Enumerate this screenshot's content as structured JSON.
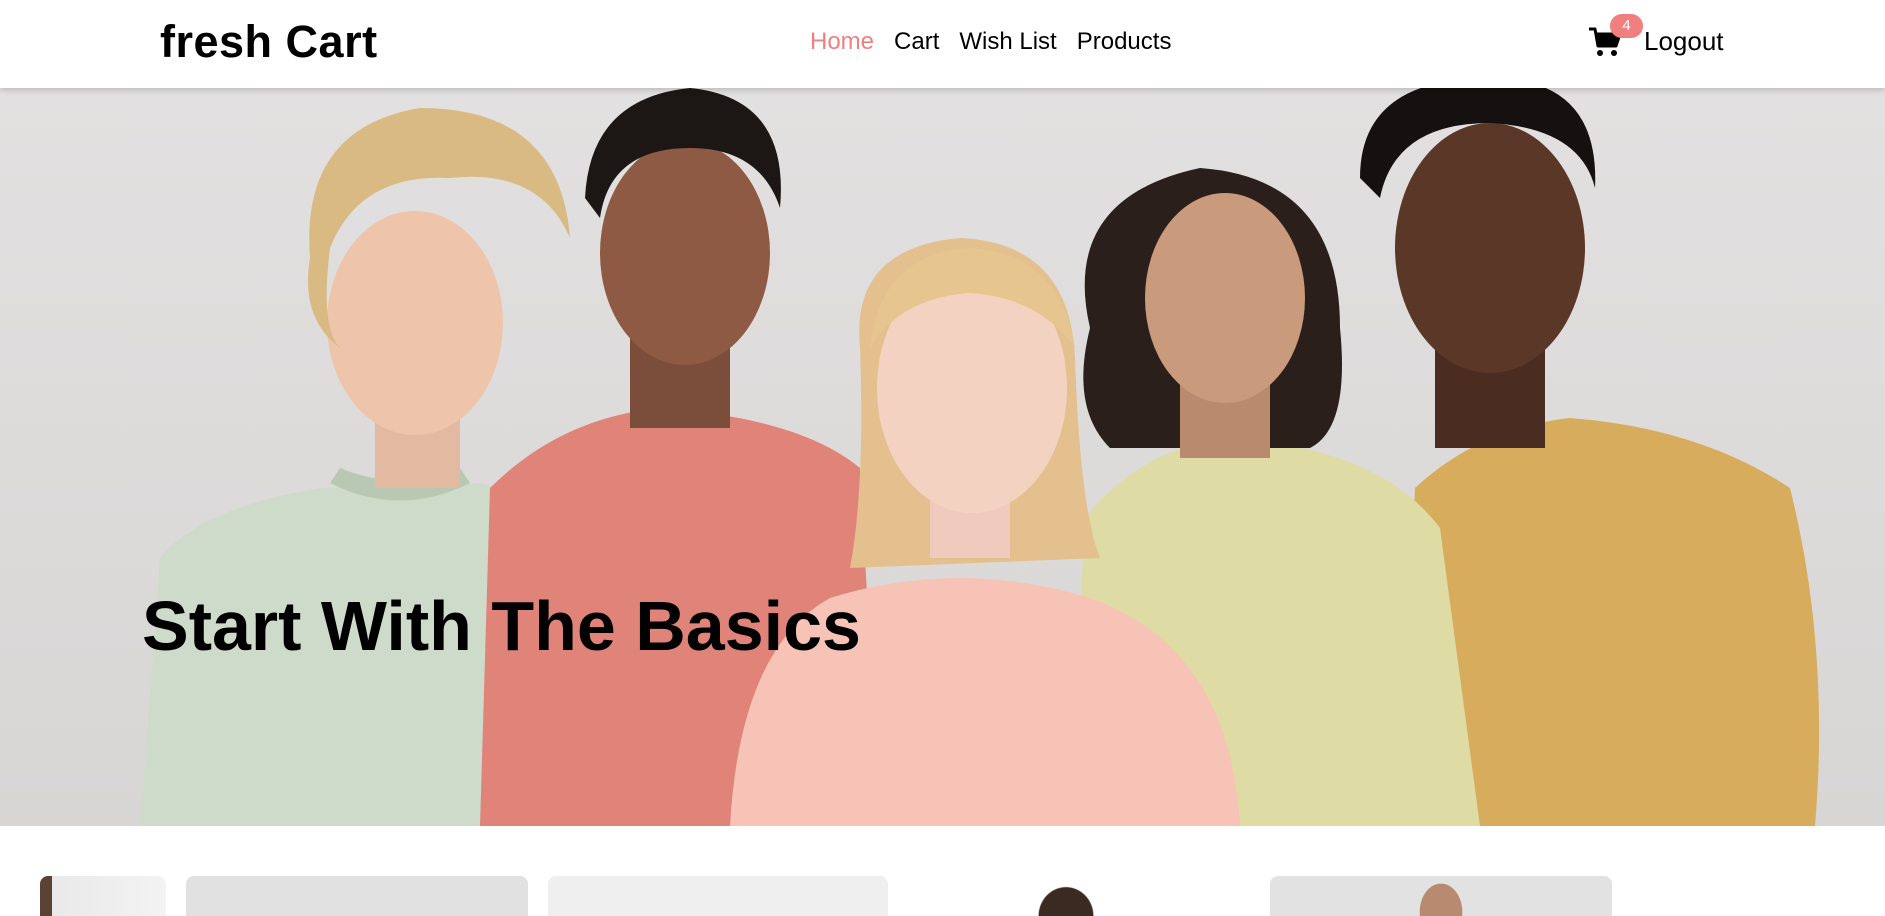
{
  "navbar": {
    "brand": "fresh Cart",
    "links": [
      {
        "label": "Home",
        "active": true
      },
      {
        "label": "Cart",
        "active": false
      },
      {
        "label": "Wish List",
        "active": false
      },
      {
        "label": "Products",
        "active": false
      }
    ],
    "cart_icon": "shopping-cart-icon",
    "cart_count": "4",
    "logout_label": "Logout"
  },
  "hero": {
    "title": "Start With The Basics",
    "image": "five-models-in-pastel-tshirts"
  },
  "colors": {
    "accent": "#f08080",
    "text": "#000000",
    "background": "#ffffff"
  }
}
